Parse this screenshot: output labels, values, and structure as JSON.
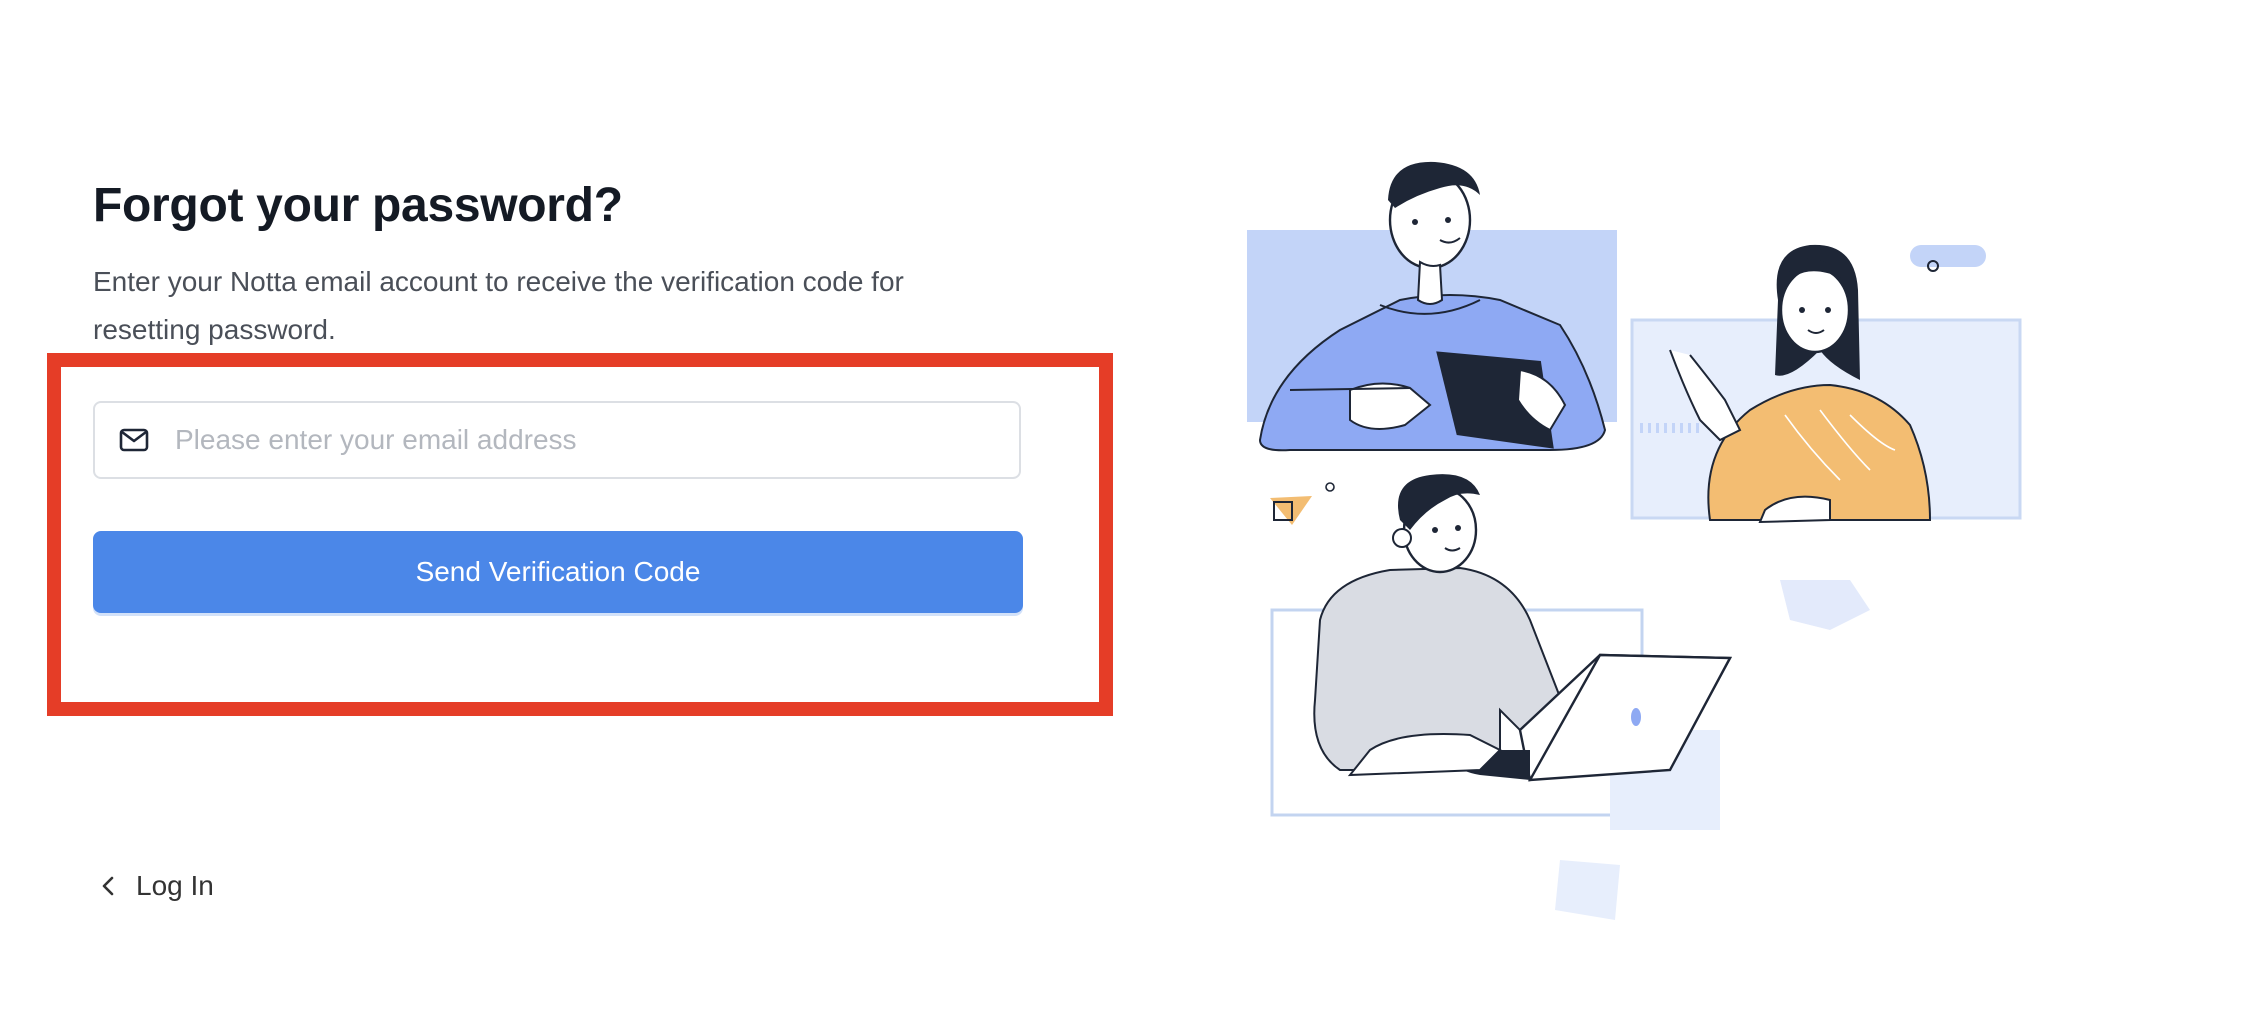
{
  "form": {
    "title": "Forgot your password?",
    "subtitle": "Enter your Notta email account to receive the verification code for resetting password.",
    "email": {
      "placeholder": "Please enter your email address",
      "value": "",
      "icon": "mail-icon"
    },
    "send_button_label": "Send Verification Code",
    "back_link": {
      "icon": "chevron-left-icon",
      "label": "Log In"
    }
  },
  "colors": {
    "primary": "#4b87e8",
    "title": "#141a24",
    "highlight": "#e53d27",
    "illustration_blue": "#c3d4f8",
    "illustration_orange": "#f3bd72"
  }
}
